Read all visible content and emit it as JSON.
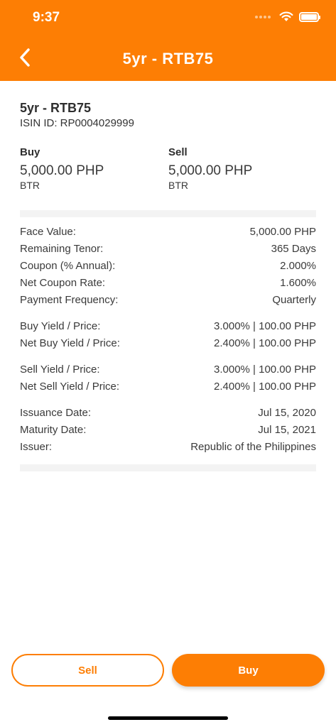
{
  "status_bar": {
    "time": "9:37"
  },
  "header": {
    "title": "5yr - RTB75"
  },
  "bond": {
    "name": "5yr - RTB75",
    "isin": "ISIN ID: RP0004029999"
  },
  "prices": {
    "buy": {
      "label": "Buy",
      "value": "5,000.00 PHP",
      "unit": "BTR"
    },
    "sell": {
      "label": "Sell",
      "value": "5,000.00 PHP",
      "unit": "BTR"
    }
  },
  "details": {
    "groups": [
      [
        {
          "label": "Face Value:",
          "value": "5,000.00 PHP"
        },
        {
          "label": "Remaining Tenor:",
          "value": "365 Days"
        },
        {
          "label": "Coupon (% Annual):",
          "value": "2.000%"
        },
        {
          "label": "Net Coupon Rate:",
          "value": "1.600%"
        },
        {
          "label": "Payment Frequency:",
          "value": "Quarterly"
        }
      ],
      [
        {
          "label": "Buy Yield / Price:",
          "value": "3.000% |  100.00 PHP"
        },
        {
          "label": "Net Buy Yield / Price:",
          "value": "2.400% |  100.00 PHP"
        }
      ],
      [
        {
          "label": "Sell Yield / Price:",
          "value": "3.000% | 100.00 PHP"
        },
        {
          "label": "Net Sell Yield / Price:",
          "value": "2.400% | 100.00 PHP"
        }
      ],
      [
        {
          "label": "Issuance Date:",
          "value": "Jul 15, 2020"
        },
        {
          "label": "Maturity Date:",
          "value": "Jul 15, 2021"
        },
        {
          "label": "Issuer:",
          "value": "Republic of the Philippines"
        }
      ]
    ]
  },
  "actions": {
    "sell_label": "Sell",
    "buy_label": "Buy"
  },
  "colors": {
    "accent": "#fd7e04",
    "text": "#3a3a3a",
    "band": "#f3f3f3"
  },
  "icons": {
    "back": "chevron-left-icon",
    "wifi": "wifi-icon",
    "battery": "battery-icon"
  }
}
